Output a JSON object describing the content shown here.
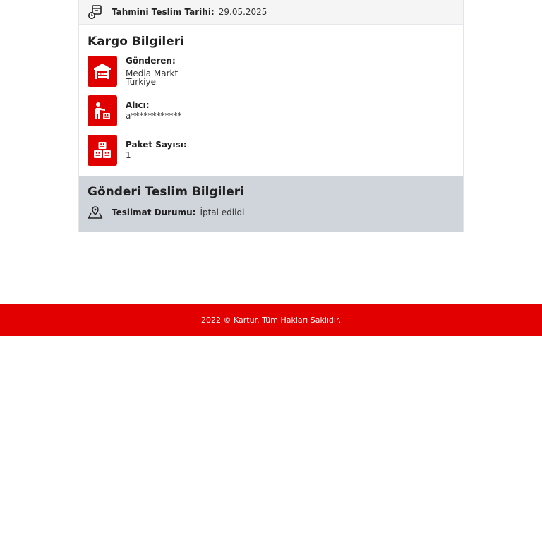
{
  "estimated_delivery": {
    "label": "Tahmini Teslim Tarihi:",
    "value": "29.05.2025",
    "icon": "delivery-box-icon"
  },
  "cargo_info": {
    "title": "Kargo Bilgileri",
    "sender": {
      "label": "Gönderen:",
      "value_line1": "Media Markt",
      "value_line2": "Türkiye",
      "icon": "warehouse-icon"
    },
    "receiver": {
      "label": "Alıcı:",
      "value": "a************",
      "icon": "person-with-parcel-icon"
    },
    "package_count": {
      "label": "Paket Sayısı:",
      "value": "1",
      "icon": "stacked-boxes-icon"
    }
  },
  "delivery_info": {
    "title": "Gönderi Teslim Bilgileri",
    "status_label": "Teslimat Durumu:",
    "status_value": "İptal edildi",
    "icon": "map-pin-icon"
  },
  "footer": {
    "text": "2022 © Kartur. Tüm Hakları Saklıdır."
  },
  "colors": {
    "brand_red": "#e00000",
    "delivery_section_bg": "#d0d4db",
    "top_row_bg": "#f5f5f6"
  }
}
